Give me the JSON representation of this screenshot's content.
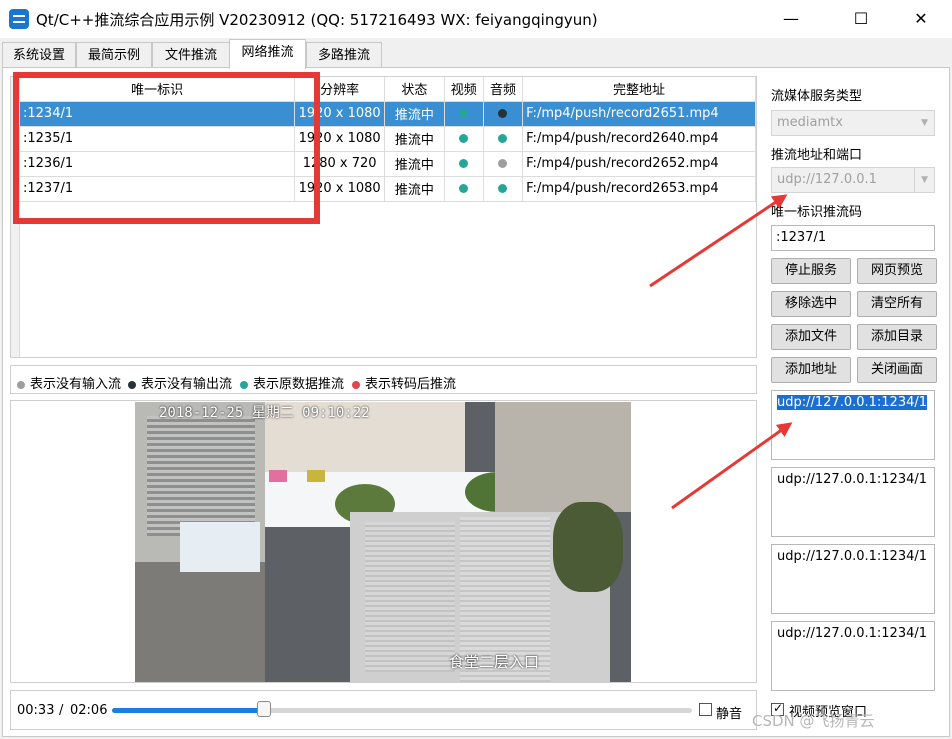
{
  "window": {
    "title": "Qt/C++推流综合应用示例 V20230912 (QQ: 517216493 WX: feiyangqingyun)",
    "minimize": "—",
    "maximize": "☐",
    "close": "✕"
  },
  "tabs": [
    {
      "label": "系统设置"
    },
    {
      "label": "最简示例"
    },
    {
      "label": "文件推流"
    },
    {
      "label": "网络推流",
      "active": true
    },
    {
      "label": "多路推流"
    }
  ],
  "table": {
    "columns": [
      "唯一标识",
      "分辨率",
      "状态",
      "视频",
      "音频",
      "完整地址"
    ],
    "rows": [
      {
        "id": ":1234/1",
        "resolution": "1920 x 1080",
        "status": "推流中",
        "video": "teal",
        "audio": "black",
        "url": "F:/mp4/push/record2651.mp4",
        "selected": true
      },
      {
        "id": ":1235/1",
        "resolution": "1920 x 1080",
        "status": "推流中",
        "video": "teal",
        "audio": "teal",
        "url": "F:/mp4/push/record2640.mp4"
      },
      {
        "id": ":1236/1",
        "resolution": "1280 x 720",
        "status": "推流中",
        "video": "teal",
        "audio": "gray",
        "url": "F:/mp4/push/record2652.mp4"
      },
      {
        "id": ":1237/1",
        "resolution": "1920 x 1080",
        "status": "推流中",
        "video": "teal",
        "audio": "teal",
        "url": "F:/mp4/push/record2653.mp4"
      }
    ]
  },
  "colors": {
    "teal": "#26a69a",
    "black": "#263238",
    "gray": "#9e9e9e",
    "red": "#e0474c",
    "selection": "#3a8fd3",
    "annotation": "#e53935"
  },
  "legend": [
    {
      "color": "gray",
      "label": "表示没有输入流"
    },
    {
      "color": "black",
      "label": "表示没有输出流"
    },
    {
      "color": "teal",
      "label": "表示原数据推流"
    },
    {
      "color": "red",
      "label": "表示转码后推流"
    }
  ],
  "video": {
    "timestamp": "2018-12-25 星期二 09:10:22",
    "caption": "食堂二层入口"
  },
  "playback": {
    "current": "00:33",
    "separator": "/",
    "duration": "02:06",
    "progress": 0.262,
    "mute_label": "静音",
    "muted": false
  },
  "right_panel": {
    "server_type_label": "流媒体服务类型",
    "server_type_value": "mediamtx",
    "push_addr_label": "推流地址和端口",
    "push_addr_value": "udp://127.0.0.1",
    "id_label": "唯一标识推流码",
    "id_value": ":1237/1",
    "buttons": {
      "stop_service": "停止服务",
      "web_preview": "网页预览",
      "remove_selected": "移除选中",
      "clear_all": "清空所有",
      "add_file": "添加文件",
      "add_dir": "添加目录",
      "add_address": "添加地址",
      "close_view": "关闭画面"
    },
    "urls": [
      "udp://127.0.0.1:1234/1",
      "udp://127.0.0.1:1234/1",
      "udp://127.0.0.1:1234/1",
      "udp://127.0.0.1:1234/1"
    ],
    "preview_label": "视频预览窗口",
    "preview_checked": true
  },
  "watermark": "CSDN @飞扬青云"
}
